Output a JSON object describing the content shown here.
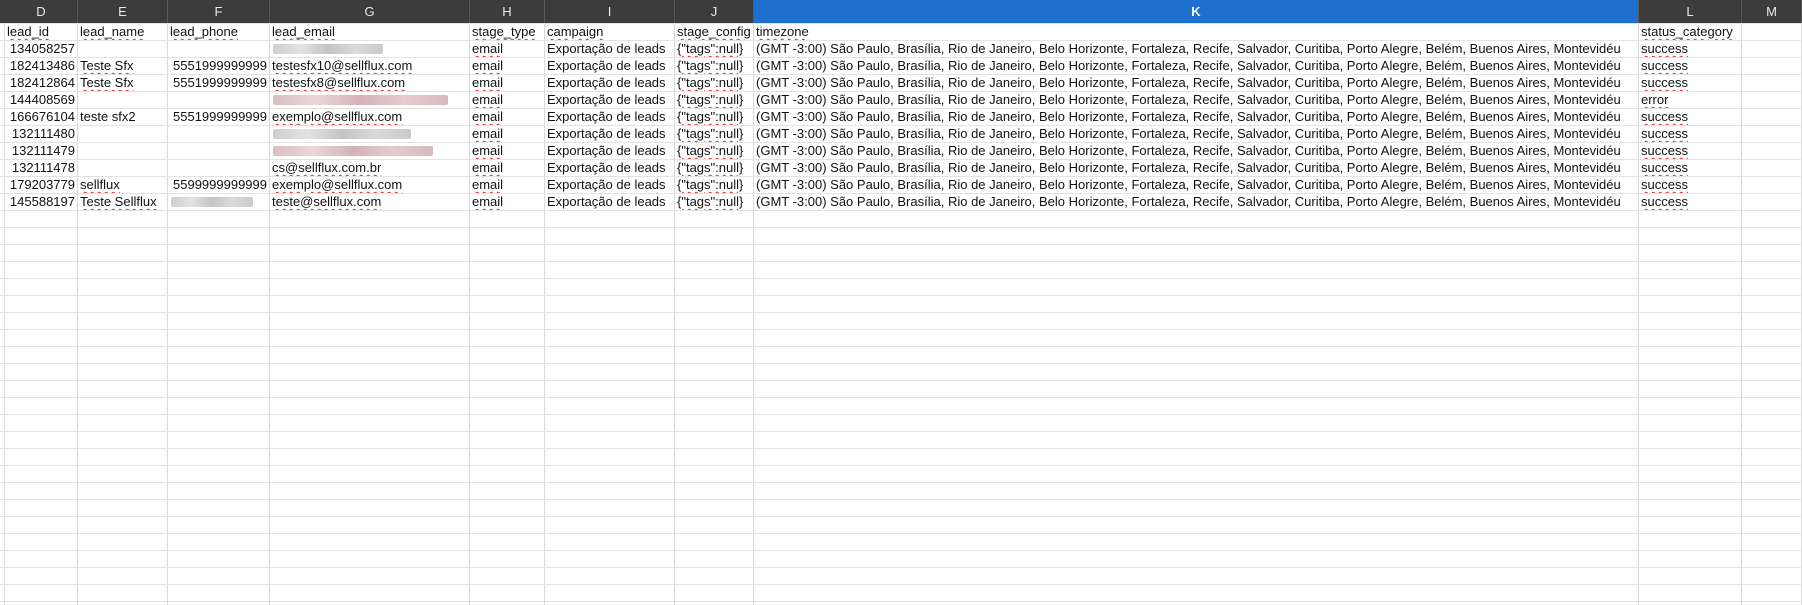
{
  "columns": [
    {
      "letter": "D",
      "header": "lead_id"
    },
    {
      "letter": "E",
      "header": "lead_name"
    },
    {
      "letter": "F",
      "header": "lead_phone"
    },
    {
      "letter": "G",
      "header": "lead_email"
    },
    {
      "letter": "H",
      "header": "stage_type"
    },
    {
      "letter": "I",
      "header": "campaign"
    },
    {
      "letter": "J",
      "header": "stage_config"
    },
    {
      "letter": "K",
      "header": "timezone"
    },
    {
      "letter": "L",
      "header": "status_category"
    },
    {
      "letter": "M",
      "header": ""
    }
  ],
  "selected_column": "K",
  "rows": [
    {
      "lead_id": "134058257",
      "lead_name": "",
      "lead_phone": "",
      "lead_email": "",
      "email_blurred": true,
      "stage_type": "email",
      "campaign": "Exportação de leads",
      "stage_config": "{\"tags\":null}",
      "timezone": "(GMT -3:00) São Paulo, Brasília, Rio de Janeiro, Belo Horizonte, Fortaleza, Recife, Salvador, Curitiba, Porto Alegre, Belém, Buenos Aires, Montevidéu",
      "status_category": "success"
    },
    {
      "lead_id": "182413486",
      "lead_name": "Teste Sfx",
      "lead_phone": "5551999999999",
      "lead_email": "testesfx10@sellflux.com",
      "stage_type": "email",
      "campaign": "Exportação de leads",
      "stage_config": "{\"tags\":null}",
      "timezone": "(GMT -3:00) São Paulo, Brasília, Rio de Janeiro, Belo Horizonte, Fortaleza, Recife, Salvador, Curitiba, Porto Alegre, Belém, Buenos Aires, Montevidéu",
      "status_category": "success"
    },
    {
      "lead_id": "182412864",
      "lead_name": "Teste Sfx",
      "lead_phone": "5551999999999",
      "lead_email": "testesfx8@sellflux.com",
      "stage_type": "email",
      "campaign": "Exportação de leads",
      "stage_config": "{\"tags\":null}",
      "timezone": "(GMT -3:00) São Paulo, Brasília, Rio de Janeiro, Belo Horizonte, Fortaleza, Recife, Salvador, Curitiba, Porto Alegre, Belém, Buenos Aires, Montevidéu",
      "status_category": "success"
    },
    {
      "lead_id": "144408569",
      "lead_name": "",
      "lead_phone": "",
      "lead_email": "",
      "email_blurred": true,
      "stage_type": "email",
      "campaign": "Exportação de leads",
      "stage_config": "{\"tags\":null}",
      "timezone": "(GMT -3:00) São Paulo, Brasília, Rio de Janeiro, Belo Horizonte, Fortaleza, Recife, Salvador, Curitiba, Porto Alegre, Belém, Buenos Aires, Montevidéu",
      "status_category": "error"
    },
    {
      "lead_id": "166676104",
      "lead_name": "teste sfx2",
      "lead_phone": "5551999999999",
      "lead_email": "exemplo@sellflux.com",
      "stage_type": "email",
      "campaign": "Exportação de leads",
      "stage_config": "{\"tags\":null}",
      "timezone": "(GMT -3:00) São Paulo, Brasília, Rio de Janeiro, Belo Horizonte, Fortaleza, Recife, Salvador, Curitiba, Porto Alegre, Belém, Buenos Aires, Montevidéu",
      "status_category": "success"
    },
    {
      "lead_id": "132111480",
      "lead_name": "",
      "lead_phone": "",
      "lead_email": "",
      "email_blurred": true,
      "stage_type": "email",
      "campaign": "Exportação de leads",
      "stage_config": "{\"tags\":null}",
      "timezone": "(GMT -3:00) São Paulo, Brasília, Rio de Janeiro, Belo Horizonte, Fortaleza, Recife, Salvador, Curitiba, Porto Alegre, Belém, Buenos Aires, Montevidéu",
      "status_category": "success"
    },
    {
      "lead_id": "132111479",
      "lead_name": "",
      "lead_phone": "",
      "lead_email": "",
      "email_blurred": true,
      "stage_type": "email",
      "campaign": "Exportação de leads",
      "stage_config": "{\"tags\":null}",
      "timezone": "(GMT -3:00) São Paulo, Brasília, Rio de Janeiro, Belo Horizonte, Fortaleza, Recife, Salvador, Curitiba, Porto Alegre, Belém, Buenos Aires, Montevidéu",
      "status_category": "success"
    },
    {
      "lead_id": "132111478",
      "lead_name": "",
      "lead_phone": "",
      "lead_email": "cs@sellflux.com.br",
      "stage_type": "email",
      "campaign": "Exportação de leads",
      "stage_config": "{\"tags\":null}",
      "timezone": "(GMT -3:00) São Paulo, Brasília, Rio de Janeiro, Belo Horizonte, Fortaleza, Recife, Salvador, Curitiba, Porto Alegre, Belém, Buenos Aires, Montevidéu",
      "status_category": "success"
    },
    {
      "lead_id": "179203779",
      "lead_name": "sellflux",
      "lead_phone": "5599999999999",
      "lead_email": "exemplo@sellflux.com",
      "stage_type": "email",
      "campaign": "Exportação de leads",
      "stage_config": "{\"tags\":null}",
      "timezone": "(GMT -3:00) São Paulo, Brasília, Rio de Janeiro, Belo Horizonte, Fortaleza, Recife, Salvador, Curitiba, Porto Alegre, Belém, Buenos Aires, Montevidéu",
      "status_category": "success"
    },
    {
      "lead_id": "145588197",
      "lead_name": "Teste Sellflux",
      "lead_phone": "",
      "phone_blurred": true,
      "lead_email": "teste@sellflux.com",
      "stage_type": "email",
      "campaign": "Exportação de leads",
      "stage_config": "{\"tags\":null}",
      "timezone": "(GMT -3:00) São Paulo, Brasília, Rio de Janeiro, Belo Horizonte, Fortaleza, Recife, Salvador, Curitiba, Porto Alegre, Belém, Buenos Aires, Montevidéu",
      "status_category": "success"
    }
  ],
  "colors": {
    "header_bg": "#3c3c3c",
    "selected_header_bg": "#1f6fcf",
    "spellcheck_underline": "#e03030"
  }
}
